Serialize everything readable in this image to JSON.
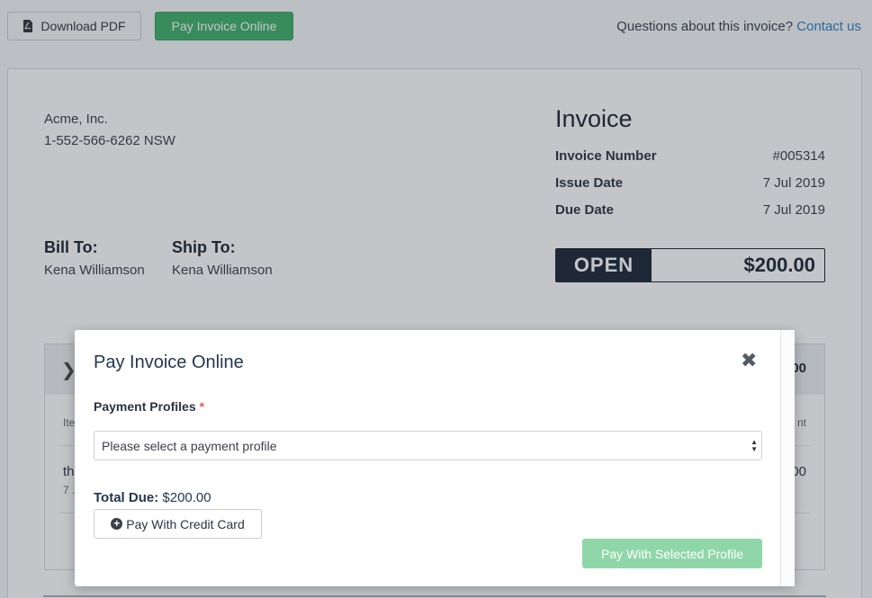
{
  "topbar": {
    "download_label": "Download PDF",
    "pay_online_label": "Pay Invoice Online",
    "questions_text": "Questions about this invoice?",
    "contact_label": "Contact us"
  },
  "company": {
    "name": "Acme, Inc.",
    "phone": "1-552-566-6262 NSW"
  },
  "invoice": {
    "title": "Invoice",
    "number_label": "Invoice Number",
    "number_value": "#005314",
    "issue_label": "Issue Date",
    "issue_value": "7 Jul 2019",
    "due_label": "Due Date",
    "due_value": "7 Jul 2019",
    "status": "OPEN",
    "amount": "$200.00"
  },
  "bill_to": {
    "heading": "Bill To:",
    "name": "Kena Williamson"
  },
  "ship_to": {
    "heading": "Ship To:",
    "name": "Kena Williamson"
  },
  "items_partial": {
    "header_amount": "00",
    "col_left": "Ite",
    "col_right": "nt",
    "row_left": "th",
    "row_sub": "7 .",
    "row_right": "00"
  },
  "modal": {
    "title": "Pay Invoice Online",
    "close_glyph": "✖",
    "payment_profiles_label": "Payment Profiles",
    "required_mark": "*",
    "select_placeholder": "Please select a payment profile",
    "total_label": "Total Due:",
    "total_value": "$200.00",
    "credit_card_label": "Pay With Credit Card",
    "selected_profile_label": "Pay With Selected Profile"
  },
  "colors": {
    "primary_green": "#3fb06a",
    "disabled_green": "#8fd7a8",
    "link_blue": "#2f80c8",
    "status_dark": "#1c2637"
  }
}
